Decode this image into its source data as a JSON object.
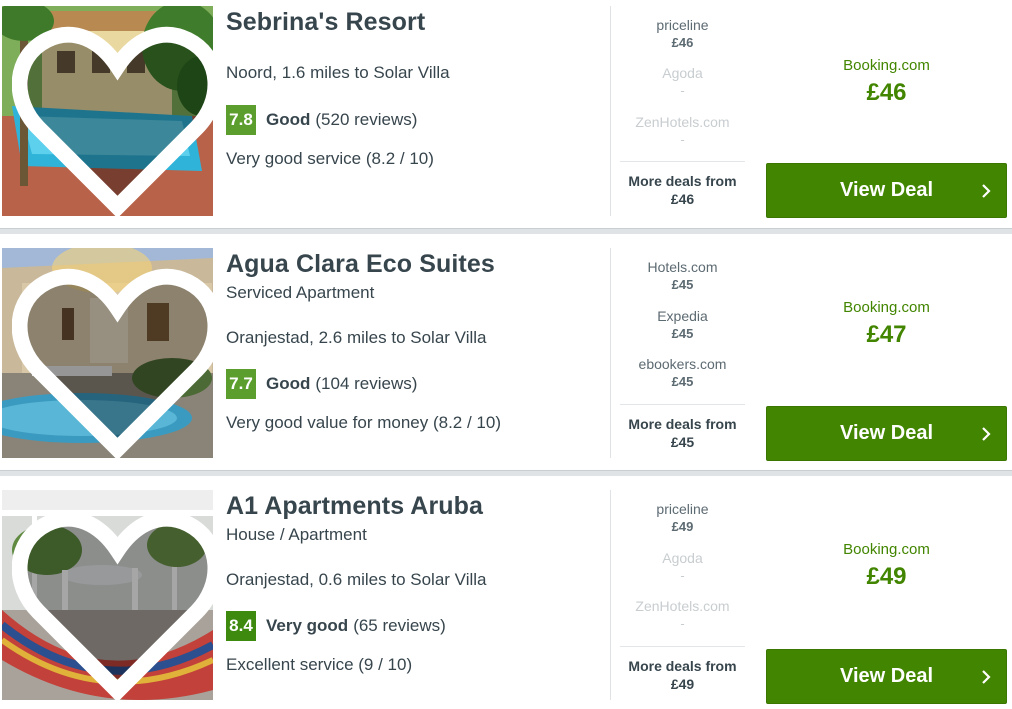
{
  "listings": [
    {
      "name": "Sebrina's Resort",
      "subtype": "",
      "location": "Noord, 1.6 miles to Solar Villa",
      "score": "7.8",
      "score_color": "#5c9e2e",
      "rating_word": "Good",
      "reviews": "(520 reviews)",
      "detail": "Very good service (8.2 / 10)",
      "alt_deals": [
        {
          "provider": "priceline",
          "price": "£46",
          "available": true
        },
        {
          "provider": "Agoda",
          "price": "-",
          "available": false
        },
        {
          "provider": "ZenHotels.com",
          "price": "-",
          "available": false
        }
      ],
      "more_label": "More deals from",
      "more_price": "£46",
      "main_provider": "Booking.com",
      "main_price": "£46",
      "button_label": "View Deal",
      "heart_icon": "heart-icon",
      "chevron_icon": "chevron-right-icon"
    },
    {
      "name": "Agua Clara Eco Suites",
      "subtype": "Serviced Apartment",
      "location": "Oranjestad, 2.6 miles to Solar Villa",
      "score": "7.7",
      "score_color": "#5c9e2e",
      "rating_word": "Good",
      "reviews": "(104 reviews)",
      "detail": "Very good value for money (8.2 / 10)",
      "alt_deals": [
        {
          "provider": "Hotels.com",
          "price": "£45",
          "available": true
        },
        {
          "provider": "Expedia",
          "price": "£45",
          "available": true
        },
        {
          "provider": "ebookers.com",
          "price": "£45",
          "available": true
        }
      ],
      "more_label": "More deals from",
      "more_price": "£45",
      "main_provider": "Booking.com",
      "main_price": "£47",
      "button_label": "View Deal",
      "heart_icon": "heart-icon",
      "chevron_icon": "chevron-right-icon"
    },
    {
      "name": "A1 Apartments Aruba",
      "subtype": "House / Apartment",
      "location": "Oranjestad, 0.6 miles to Solar Villa",
      "score": "8.4",
      "score_color": "#3d8a0f",
      "rating_word": "Very good",
      "reviews": "(65 reviews)",
      "detail": "Excellent service (9 / 10)",
      "alt_deals": [
        {
          "provider": "priceline",
          "price": "£49",
          "available": true
        },
        {
          "provider": "Agoda",
          "price": "-",
          "available": false
        },
        {
          "provider": "ZenHotels.com",
          "price": "-",
          "available": false
        }
      ],
      "more_label": "More deals from",
      "more_price": "£49",
      "main_provider": "Booking.com",
      "main_price": "£49",
      "button_label": "View Deal",
      "heart_icon": "heart-icon",
      "chevron_icon": "chevron-right-icon"
    }
  ],
  "colors": {
    "deal_green": "#428500",
    "text_dark": "#37454d",
    "text_muted": "#5c6a72",
    "disabled": "#c8cdd0"
  }
}
